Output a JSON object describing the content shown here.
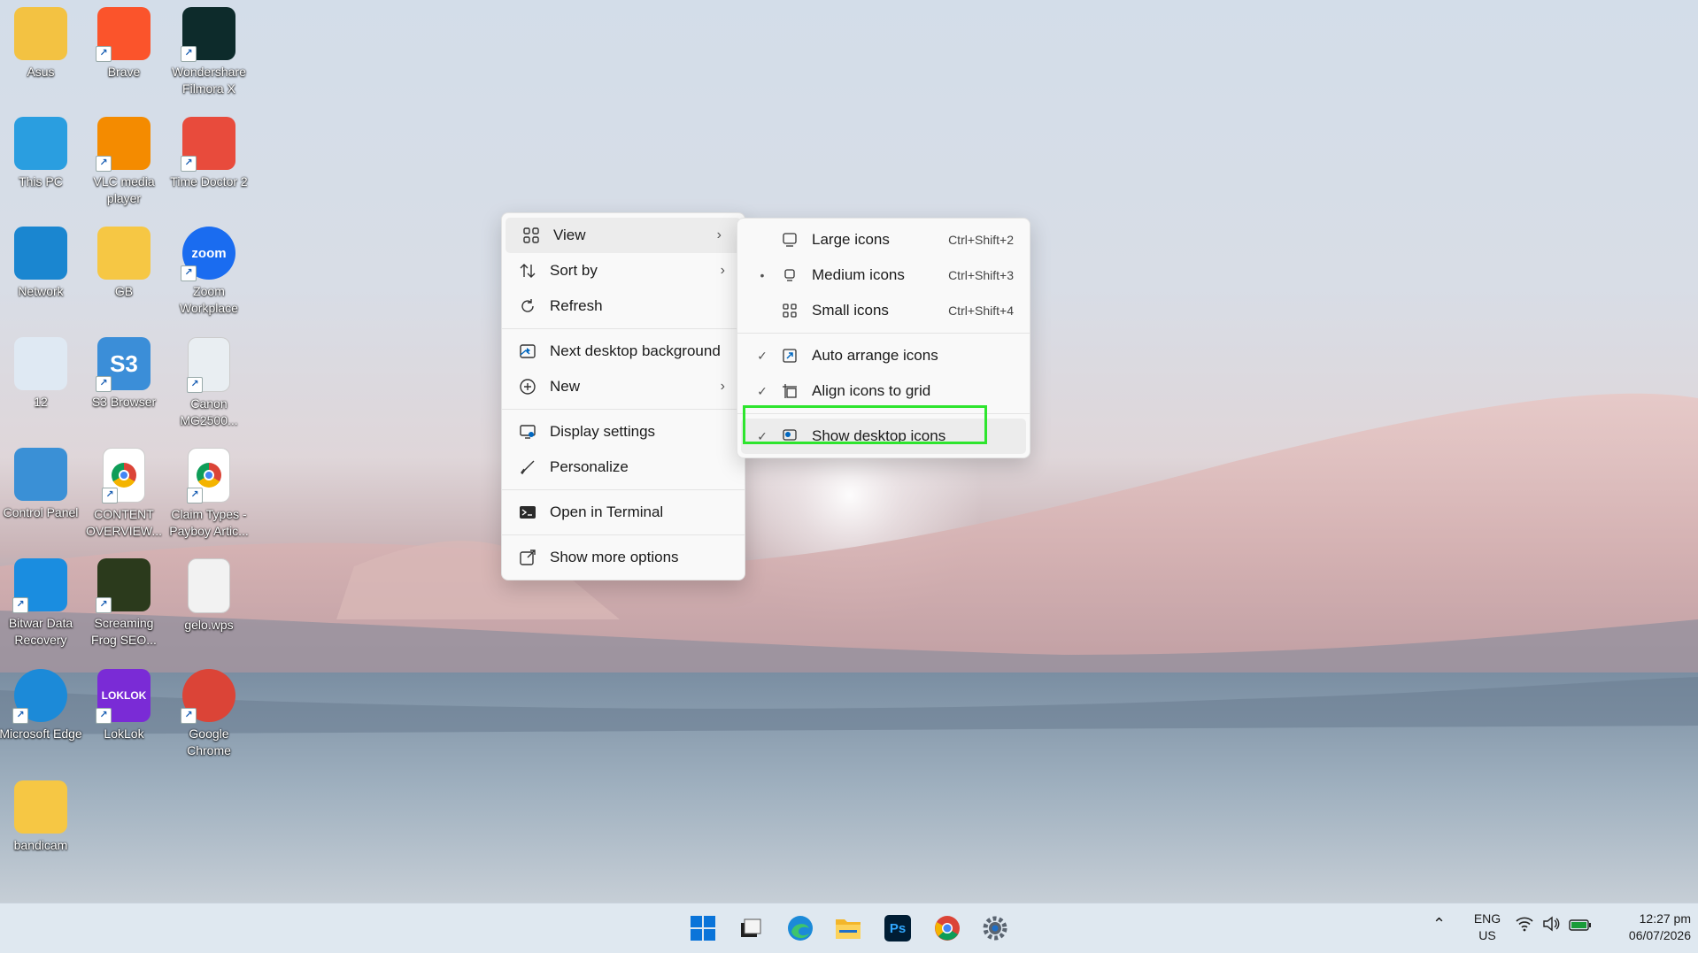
{
  "desktop_icons": [
    {
      "label": "Asus",
      "icon": "user-folder-icon"
    },
    {
      "label": "Brave",
      "icon": "brave-icon"
    },
    {
      "label": "Wondershare Filmora X",
      "icon": "filmora-icon"
    },
    {
      "label": "This PC",
      "icon": "monitor-icon"
    },
    {
      "label": "VLC media player",
      "icon": "vlc-icon"
    },
    {
      "label": "Time Doctor 2",
      "icon": "time-doctor-icon"
    },
    {
      "label": "Network",
      "icon": "network-icon"
    },
    {
      "label": "GB",
      "icon": "folder-icon"
    },
    {
      "label": "Zoom Workplace",
      "icon": "zoom-icon"
    },
    {
      "label": "12",
      "icon": "recycle-bin-icon"
    },
    {
      "label": "S3 Browser",
      "icon": "s3-browser-icon"
    },
    {
      "label": "Canon MG2500...",
      "icon": "canon-help-icon"
    },
    {
      "label": "Control Panel",
      "icon": "control-panel-icon"
    },
    {
      "label": "CONTENT OVERVIEW...",
      "icon": "chrome-doc-icon"
    },
    {
      "label": "Claim Types - Payboy Artic...",
      "icon": "chrome-doc-icon"
    },
    {
      "label": "Bitwar Data Recovery",
      "icon": "bitwar-icon"
    },
    {
      "label": "Screaming Frog SEO...",
      "icon": "screaming-frog-icon"
    },
    {
      "label": "gelo.wps",
      "icon": "blank-file-icon"
    },
    {
      "label": "Microsoft Edge",
      "icon": "edge-icon"
    },
    {
      "label": "LokLok",
      "icon": "loklok-icon"
    },
    {
      "label": "Google Chrome",
      "icon": "chrome-icon"
    },
    {
      "label": "bandicam",
      "icon": "folder-icon"
    }
  ],
  "icon_text": {
    "zoom": "zoom",
    "s3": "S3",
    "loklok": "LOKLOK"
  },
  "context_menu": {
    "items": [
      {
        "label": "View",
        "icon": "grid-icon",
        "submenu": true
      },
      {
        "label": "Sort by",
        "icon": "sort-icon",
        "submenu": true
      },
      {
        "label": "Refresh",
        "icon": "refresh-icon",
        "submenu": false
      },
      {
        "label": "Next desktop background",
        "icon": "next-background-icon",
        "submenu": false
      },
      {
        "label": "New",
        "icon": "plus-circle-icon",
        "submenu": true
      },
      {
        "label": "Display settings",
        "icon": "display-settings-icon",
        "submenu": false
      },
      {
        "label": "Personalize",
        "icon": "brush-icon",
        "submenu": false
      },
      {
        "label": "Open in Terminal",
        "icon": "terminal-icon",
        "submenu": false
      },
      {
        "label": "Show more options",
        "icon": "share-icon",
        "submenu": false
      }
    ]
  },
  "view_submenu": {
    "items": [
      {
        "label": "Large icons",
        "shortcut": "Ctrl+Shift+2",
        "mark": "",
        "icon": "large-icons-icon"
      },
      {
        "label": "Medium icons",
        "shortcut": "Ctrl+Shift+3",
        "mark": "•",
        "icon": "medium-icons-icon"
      },
      {
        "label": "Small icons",
        "shortcut": "Ctrl+Shift+4",
        "mark": "",
        "icon": "small-icons-icon"
      },
      {
        "label": "Auto arrange icons",
        "shortcut": "",
        "mark": "✓",
        "icon": "auto-arrange-icon"
      },
      {
        "label": "Align icons to grid",
        "shortcut": "",
        "mark": "✓",
        "icon": "align-grid-icon"
      },
      {
        "label": "Show desktop icons",
        "shortcut": "",
        "mark": "✓",
        "icon": "show-desktop-icon"
      }
    ]
  },
  "taskbar": {
    "apps": [
      "start-icon",
      "task-view-icon",
      "edge-icon",
      "file-explorer-icon",
      "photoshop-icon",
      "chrome-icon",
      "settings-icon"
    ],
    "ps_label": "Ps",
    "lang_top": "ENG",
    "lang_bottom": "US",
    "time": "12:27 pm",
    "date": "06/07/2026"
  },
  "colors": {
    "highlight": "#2ee52e",
    "accent": "#0067c0"
  }
}
